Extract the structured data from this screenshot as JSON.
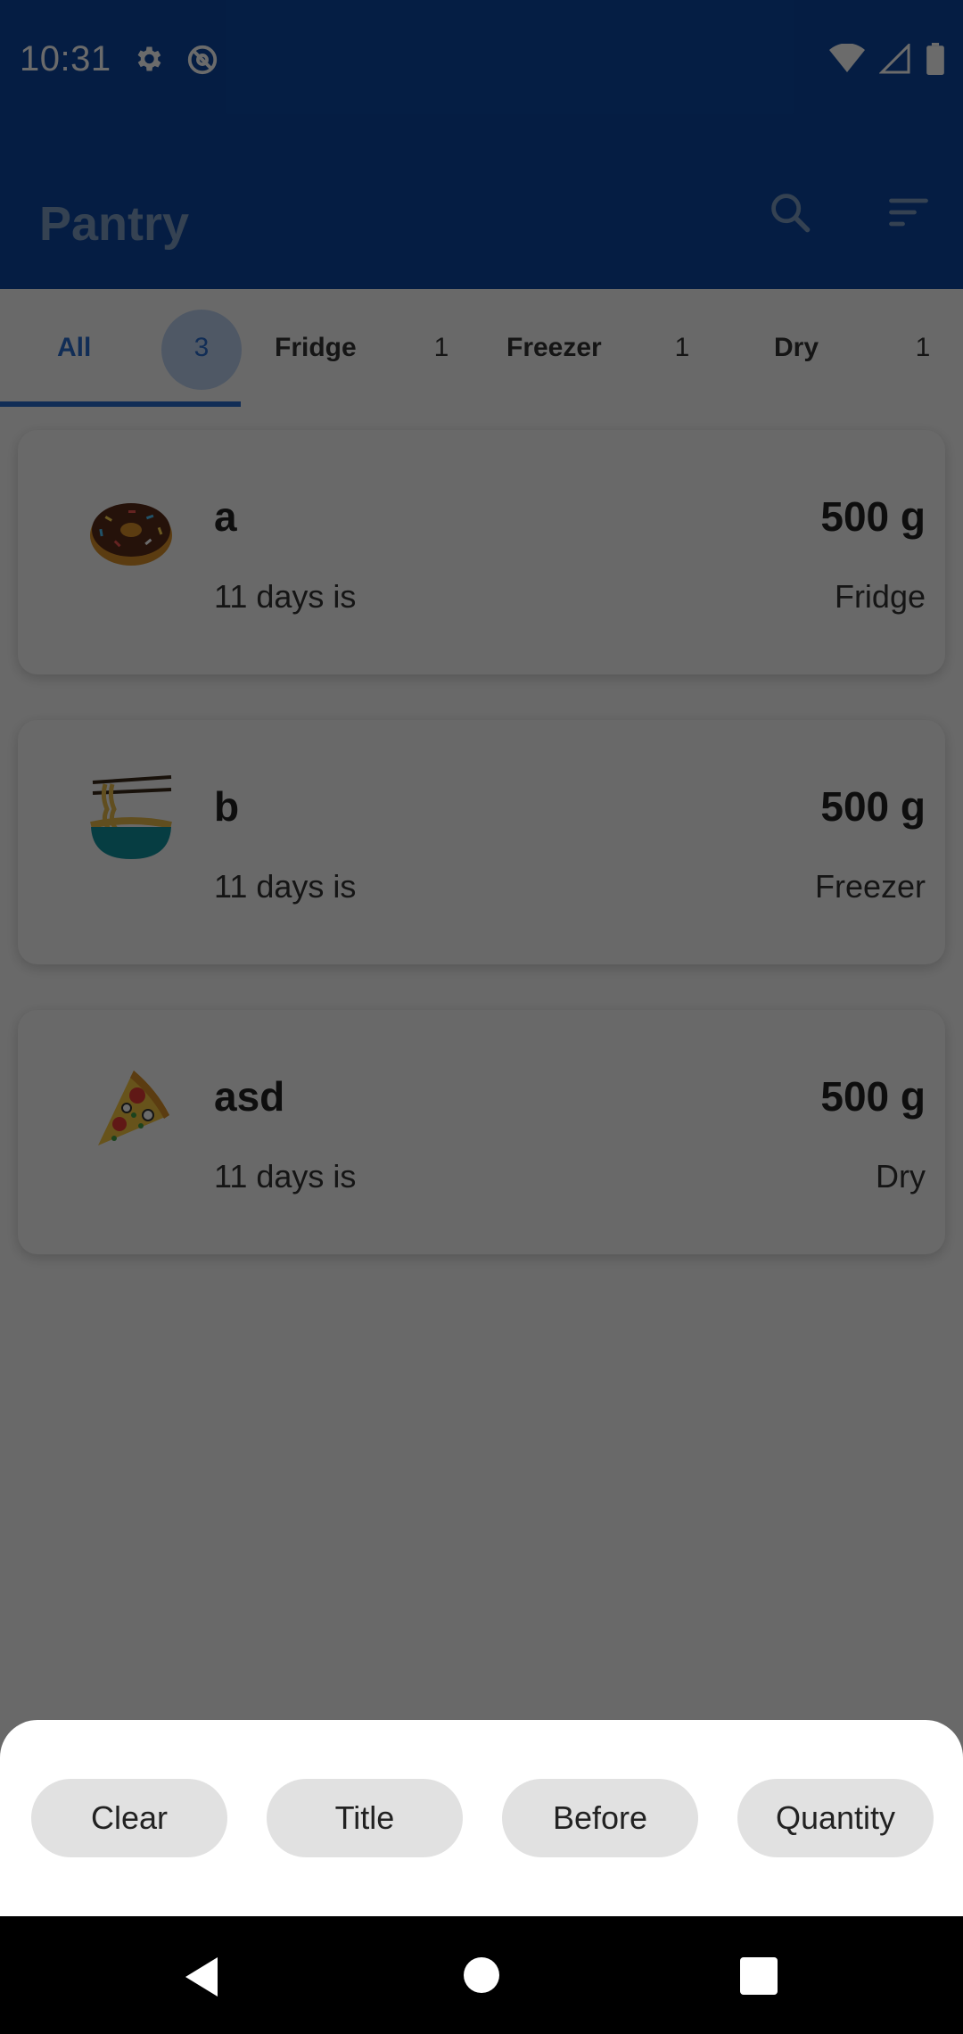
{
  "status_bar": {
    "time": "10:31",
    "left_icons": [
      "gear-icon",
      "at-sign-icon"
    ],
    "right_icons": [
      "wifi-icon",
      "signal-icon",
      "battery-icon"
    ]
  },
  "app_bar": {
    "title": "Pantry",
    "actions": [
      "search-icon",
      "sort-icon"
    ]
  },
  "tabs": [
    {
      "label": "All",
      "count": "3",
      "selected": true
    },
    {
      "label": "Fridge",
      "count": "1",
      "selected": false
    },
    {
      "label": "Freezer",
      "count": "1",
      "selected": false
    },
    {
      "label": "Dry",
      "count": "1",
      "selected": false
    }
  ],
  "items": [
    {
      "title": "a",
      "expiry": "11 days is",
      "quantity": "500 g",
      "location": "Fridge",
      "icon": "donut-icon"
    },
    {
      "title": "b",
      "expiry": "11 days is",
      "quantity": "500 g",
      "location": "Freezer",
      "icon": "noodles-icon"
    },
    {
      "title": "asd",
      "expiry": "11 days is",
      "quantity": "500 g",
      "location": "Dry",
      "icon": "pizza-icon"
    }
  ],
  "sort_sheet": {
    "options": [
      "Clear",
      "Title",
      "Before",
      "Quantity"
    ]
  },
  "nav_bar": {
    "buttons": [
      "back-icon",
      "home-icon",
      "recents-icon"
    ]
  },
  "colors": {
    "primary": "#0d47a1",
    "accent": "#2a6ccd",
    "chip": "#e1e1e1"
  }
}
